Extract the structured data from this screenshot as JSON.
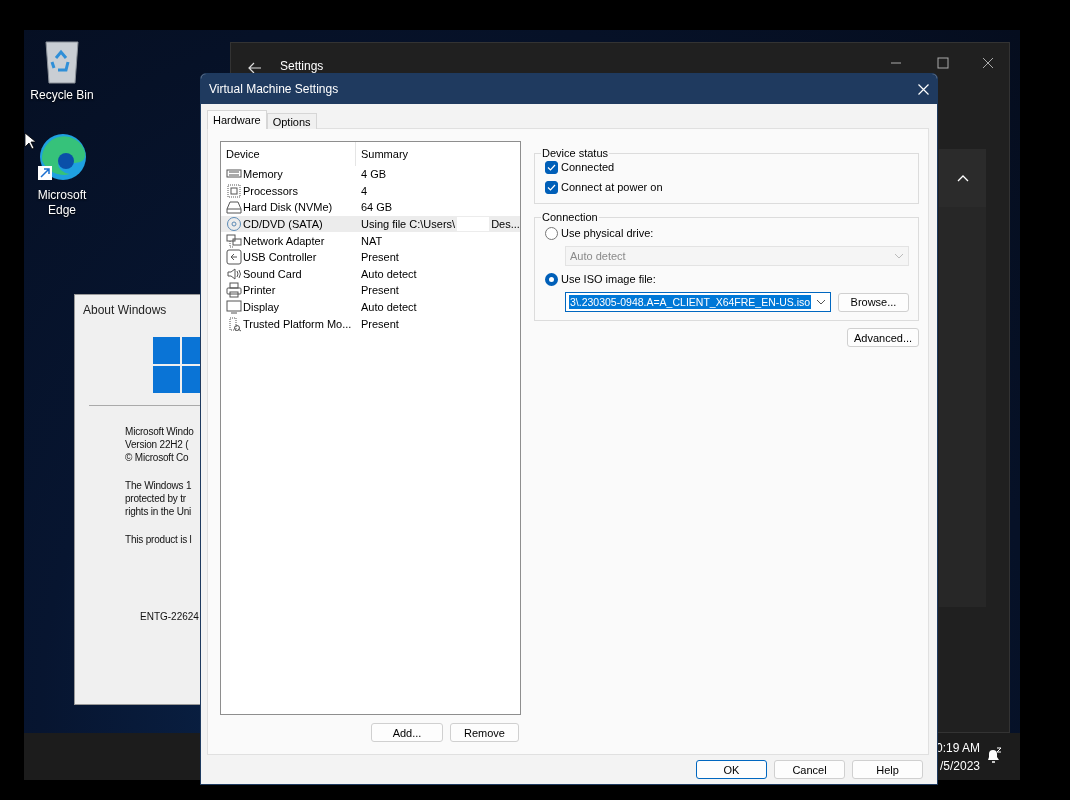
{
  "desktop": {
    "icons": [
      {
        "label": "Recycle Bin",
        "kind": "bin"
      },
      {
        "label": "Microsoft Edge",
        "kind": "browser",
        "shortcut": true
      }
    ]
  },
  "settings_window": {
    "title": "Settings"
  },
  "about_window": {
    "title": "About Windows",
    "blocks": [
      [
        "Microsoft Windo",
        "Version 22H2 (",
        "© Microsoft Co"
      ],
      [
        "The Windows 1",
        "protected by tr",
        "rights in the Uni"
      ],
      [
        "This product is l"
      ]
    ],
    "code": "ENTG-22624"
  },
  "taskbar": {
    "time": "0:19 AM",
    "date": "/5/2023"
  },
  "dialog": {
    "title": "Virtual Machine Settings",
    "tabs": [
      {
        "label": "Hardware",
        "selected": true
      },
      {
        "label": "Options",
        "selected": false
      }
    ],
    "columns": [
      "Device",
      "Summary"
    ],
    "devices": [
      {
        "kind": "memory",
        "name": "Memory",
        "summary": "4 GB",
        "selected": false
      },
      {
        "kind": "cpu",
        "name": "Processors",
        "summary": "4",
        "selected": false
      },
      {
        "kind": "disk",
        "name": "Hard Disk (NVMe)",
        "summary": "64 GB",
        "selected": false
      },
      {
        "kind": "disc",
        "name": "CD/DVD (SATA)",
        "summary": "Using file C:\\Users\\",
        "summary_end": "Des...",
        "selected": true
      },
      {
        "kind": "network",
        "name": "Network Adapter",
        "summary": "NAT",
        "selected": false
      },
      {
        "kind": "usb",
        "name": "USB Controller",
        "summary": "Present",
        "selected": false
      },
      {
        "kind": "sound",
        "name": "Sound Card",
        "summary": "Auto detect",
        "selected": false
      },
      {
        "kind": "printer",
        "name": "Printer",
        "summary": "Present",
        "selected": false
      },
      {
        "kind": "display",
        "name": "Display",
        "summary": "Auto detect",
        "selected": false
      },
      {
        "kind": "tpm",
        "name": "Trusted Platform Mo...",
        "summary": "Present",
        "selected": false
      }
    ],
    "list_buttons": [
      "Add...",
      "Remove"
    ],
    "device_status": {
      "title": "Device status",
      "options": [
        {
          "label": "Connected",
          "checked": true
        },
        {
          "label": "Connect at power on",
          "checked": true
        }
      ]
    },
    "connection": {
      "title": "Connection",
      "options": [
        {
          "label": "Use physical drive:",
          "selected": false,
          "dropdown": {
            "value": "Auto detect",
            "disabled": true,
            "highlighted": false
          }
        },
        {
          "label": "Use ISO image file:",
          "selected": true,
          "dropdown": {
            "value": "3\\.230305-0948.A=A_CLIENT_X64FRE_EN-US.iso",
            "disabled": false,
            "highlighted": true
          },
          "button": "Browse..."
        }
      ]
    },
    "advanced": "Advanced...",
    "buttons": [
      {
        "label": "OK",
        "default": true
      },
      {
        "label": "Cancel",
        "default": false
      },
      {
        "label": "Help",
        "default": false
      }
    ]
  }
}
